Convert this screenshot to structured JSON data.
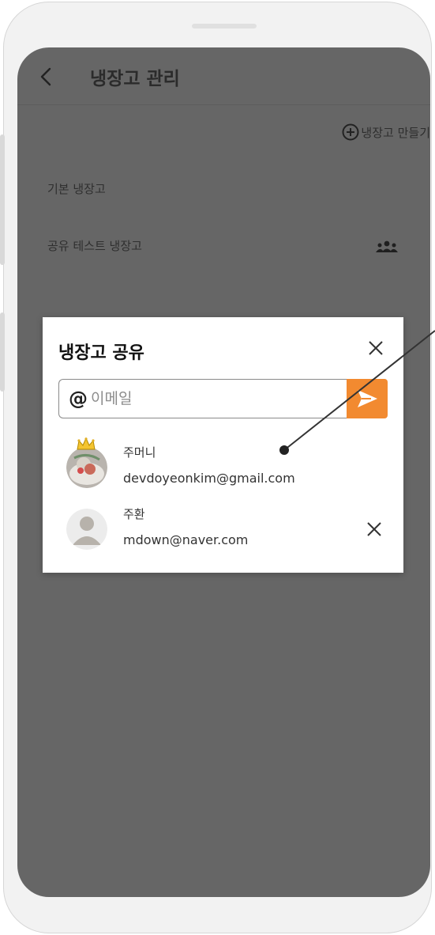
{
  "header": {
    "title": "냉장고 관리",
    "back_icon": "chevron-left-icon"
  },
  "toolbar": {
    "create_label": "냉장고 만들기",
    "create_icon": "plus-circle-icon"
  },
  "fridges": [
    {
      "name": "기본 냉장고",
      "shared": false
    },
    {
      "name": "공유 테스트 냉장고",
      "shared": true,
      "shared_icon": "people-icon"
    }
  ],
  "dialog": {
    "title": "냉장고 공유",
    "close_icon": "close-icon",
    "email_prefix": "@",
    "email_placeholder": "이메일",
    "email_value": "",
    "send_icon": "send-icon",
    "members": [
      {
        "name": "주머니",
        "email": "devdoyeonkim@gmail.com",
        "owner": true,
        "avatar": "photo-avatar",
        "badge": "crown-icon"
      },
      {
        "name": "주환",
        "email": "mdown@naver.com",
        "owner": false,
        "avatar": "default-avatar",
        "remove_icon": "close-icon"
      }
    ]
  },
  "colors": {
    "screen_bg": "#666666",
    "accent": "#f28a30",
    "dialog_bg": "#ffffff"
  }
}
